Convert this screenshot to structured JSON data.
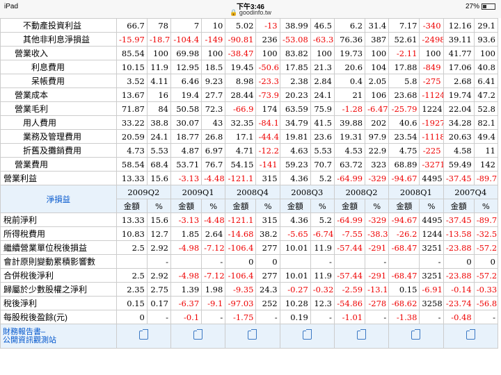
{
  "status": {
    "device": "iPad",
    "time": "下午3:46",
    "url": "goodinfo.tw",
    "battery": "27%"
  },
  "sec1": [
    {
      "label": "不動產投資利益",
      "indent": "i2",
      "v": [
        "66.7",
        "78",
        "7",
        "10",
        "5.02",
        "-13",
        "38.99",
        "46.5",
        "6.2",
        "31.4",
        "7.17",
        "-340",
        "12.16",
        "29.1"
      ]
    },
    {
      "label": "其他非利息淨損益",
      "indent": "i2",
      "v": [
        "-15.97",
        "-18.7",
        "-104.4",
        "-149",
        "-90.81",
        "236",
        "-53.08",
        "-63.3",
        "76.36",
        "387",
        "52.61",
        "-2498",
        "39.11",
        "93.6"
      ]
    },
    {
      "label": "營業收入",
      "indent": "i1",
      "v": [
        "85.54",
        "100",
        "69.98",
        "100",
        "-38.47",
        "100",
        "83.82",
        "100",
        "19.73",
        "100",
        "-2.11",
        "100",
        "41.77",
        "100"
      ]
    },
    {
      "label": "利息費用",
      "indent": "i3",
      "v": [
        "10.15",
        "11.9",
        "12.95",
        "18.5",
        "19.45",
        "-50.6",
        "17.85",
        "21.3",
        "20.6",
        "104",
        "17.88",
        "-849",
        "17.06",
        "40.8"
      ]
    },
    {
      "label": "呆帳費用",
      "indent": "i3",
      "v": [
        "3.52",
        "4.11",
        "6.46",
        "9.23",
        "8.98",
        "-23.3",
        "2.38",
        "2.84",
        "0.4",
        "2.05",
        "5.8",
        "-275",
        "2.68",
        "6.41"
      ]
    },
    {
      "label": "營業成本",
      "indent": "i1",
      "v": [
        "13.67",
        "16",
        "19.4",
        "27.7",
        "28.44",
        "-73.9",
        "20.23",
        "24.1",
        "21",
        "106",
        "23.68",
        "-1124",
        "19.74",
        "47.2"
      ]
    },
    {
      "label": "營業毛利",
      "indent": "i1",
      "v": [
        "71.87",
        "84",
        "50.58",
        "72.3",
        "-66.9",
        "174",
        "63.59",
        "75.9",
        "-1.28",
        "-6.47",
        "-25.79",
        "1224",
        "22.04",
        "52.8"
      ]
    },
    {
      "label": "用人費用",
      "indent": "i2",
      "v": [
        "33.22",
        "38.8",
        "30.07",
        "43",
        "32.35",
        "-84.1",
        "34.79",
        "41.5",
        "39.88",
        "202",
        "40.6",
        "-1927",
        "34.28",
        "82.1"
      ]
    },
    {
      "label": "業務及管理費用",
      "indent": "i2",
      "v": [
        "20.59",
        "24.1",
        "18.77",
        "26.8",
        "17.1",
        "-44.4",
        "19.81",
        "23.6",
        "19.31",
        "97.9",
        "23.54",
        "-1118",
        "20.63",
        "49.4"
      ]
    },
    {
      "label": "折舊及攤銷費用",
      "indent": "i2",
      "v": [
        "4.73",
        "5.53",
        "4.87",
        "6.97",
        "4.71",
        "-12.2",
        "4.63",
        "5.53",
        "4.53",
        "22.9",
        "4.75",
        "-225",
        "4.58",
        "11"
      ]
    },
    {
      "label": "營業費用",
      "indent": "i1",
      "v": [
        "58.54",
        "68.4",
        "53.71",
        "76.7",
        "54.15",
        "-141",
        "59.23",
        "70.7",
        "63.72",
        "323",
        "68.89",
        "-3271",
        "59.49",
        "142"
      ]
    },
    {
      "label": "營業利益",
      "indent": "i0",
      "v": [
        "13.33",
        "15.6",
        "-3.13",
        "-4.48",
        "-121.1",
        "315",
        "4.36",
        "5.2",
        "-64.99",
        "-329",
        "-94.67",
        "4495",
        "-37.45",
        "-89.7"
      ]
    }
  ],
  "header": {
    "title": "淨損益",
    "periods": [
      "2009Q2",
      "2009Q1",
      "2008Q4",
      "2008Q3",
      "2008Q2",
      "2008Q1",
      "2007Q4"
    ],
    "amount": "金額",
    "pct": "%"
  },
  "sec2": [
    {
      "label": "稅前淨利",
      "v": [
        "13.33",
        "15.6",
        "-3.13",
        "-4.48",
        "-121.1",
        "315",
        "4.36",
        "5.2",
        "-64.99",
        "-329",
        "-94.67",
        "4495",
        "-37.45",
        "-89.7"
      ]
    },
    {
      "label": "所得稅費用",
      "v": [
        "10.83",
        "12.7",
        "1.85",
        "2.64",
        "-14.68",
        "38.2",
        "-5.65",
        "-6.74",
        "-7.55",
        "-38.3",
        "-26.2",
        "1244",
        "-13.58",
        "-32.5"
      ]
    },
    {
      "label": "繼續營業單位稅後損益",
      "v": [
        "2.5",
        "2.92",
        "-4.98",
        "-7.12",
        "-106.4",
        "277",
        "10.01",
        "11.9",
        "-57.44",
        "-291",
        "-68.47",
        "3251",
        "-23.88",
        "-57.2"
      ]
    },
    {
      "label": "會計原則變動累積影響數",
      "v": [
        "",
        "-",
        "",
        "-",
        "0",
        "0",
        "",
        "-",
        "",
        "-",
        "",
        "-",
        "0",
        "0"
      ]
    },
    {
      "label": "合併稅後淨利",
      "v": [
        "2.5",
        "2.92",
        "-4.98",
        "-7.12",
        "-106.4",
        "277",
        "10.01",
        "11.9",
        "-57.44",
        "-291",
        "-68.47",
        "3251",
        "-23.88",
        "-57.2"
      ]
    },
    {
      "label": "歸屬於少數股權之淨利",
      "v": [
        "2.35",
        "2.75",
        "1.39",
        "1.98",
        "-9.35",
        "24.3",
        "-0.27",
        "-0.32",
        "-2.59",
        "-13.1",
        "0.15",
        "-6.91",
        "-0.14",
        "-0.33"
      ]
    },
    {
      "label": "稅後淨利",
      "v": [
        "0.15",
        "0.17",
        "-6.37",
        "-9.1",
        "-97.03",
        "252",
        "10.28",
        "12.3",
        "-54.86",
        "-278",
        "-68.62",
        "3258",
        "-23.74",
        "-56.8"
      ]
    },
    {
      "label": "每股稅後盈餘(元)",
      "v": [
        "0",
        "-",
        "-0.1",
        "-",
        "-1.75",
        "-",
        "0.19",
        "-",
        "-1.01",
        "-",
        "-1.38",
        "-",
        "-0.48",
        "-"
      ]
    }
  ],
  "footer": {
    "line1": "財務報告書–",
    "line2": "公開資訊觀測站"
  }
}
